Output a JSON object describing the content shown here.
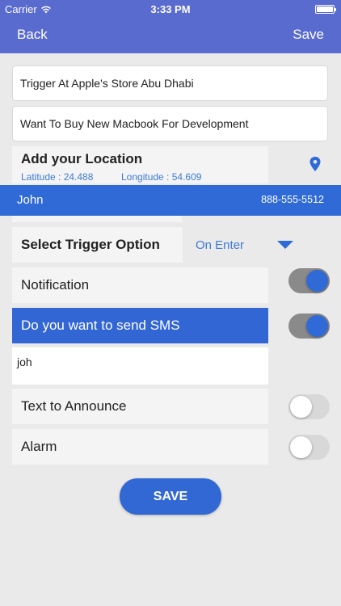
{
  "status_bar": {
    "carrier": "Carrier",
    "time": "3:33 PM"
  },
  "nav": {
    "back_label": "Back",
    "save_label": "Save"
  },
  "trigger_name": "Trigger At Apple's Store Abu Dhabi",
  "trigger_description": "Want To Buy New Macbook For Development",
  "location": {
    "title": "Add your Location",
    "latitude": "Latitude : 24.488",
    "longitude": "Longitude : 54.609"
  },
  "contact_suggestion": {
    "name": "John",
    "phone": "888-555-5512"
  },
  "trigger_option": {
    "label": "Select Trigger Option",
    "value": "On Enter"
  },
  "options": {
    "notification": {
      "label": "Notification",
      "enabled": true
    },
    "sms": {
      "label": "Do you want to send SMS",
      "enabled": true,
      "input_value": "joh"
    },
    "announce": {
      "label": "Text to Announce",
      "enabled": false
    },
    "alarm": {
      "label": "Alarm",
      "enabled": false
    }
  },
  "save_button": "SAVE",
  "colors": {
    "nav_bg": "#5a6bd0",
    "accent": "#2f6ad6",
    "link_blue": "#3d7bd6",
    "background": "#eaeaea"
  }
}
